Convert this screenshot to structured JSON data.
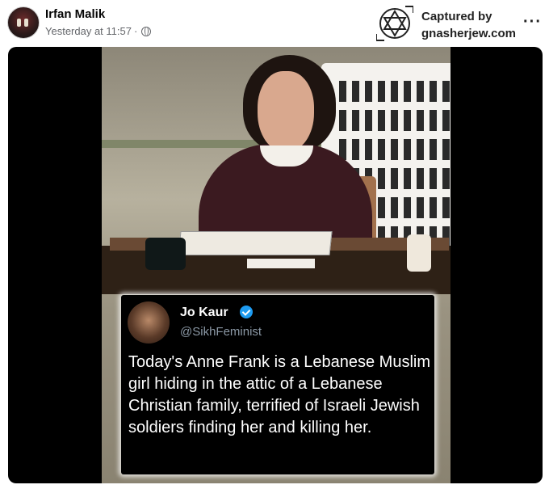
{
  "post": {
    "author_name": "Irfan Malik",
    "timestamp": "Yesterday at 11:57",
    "separator": "·",
    "privacy_icon": "globe-icon",
    "more_label": "···"
  },
  "watermark": {
    "line1": "Captured by",
    "line2": "gnasherjew.com",
    "logo_icon": "star-of-david-icon"
  },
  "tweet": {
    "name": "Jo Kaur",
    "handle": "@SikhFeminist",
    "verified_icon": "verified-badge-icon",
    "text": "Today's Anne Frank is a Lebanese Muslim girl hiding in the attic of a Lebanese Christian family, terrified of Israeli Jewish soldiers finding her and killing her."
  },
  "colors": {
    "verified": "#1d9bf0",
    "meta_text": "#65676b",
    "media_bg": "#000000"
  }
}
